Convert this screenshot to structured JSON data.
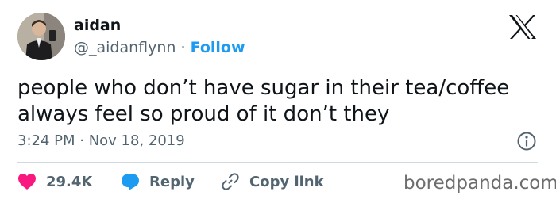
{
  "author": {
    "name": "aidan",
    "handle": "@_aidanflynn",
    "separator": "·",
    "follow_label": "Follow"
  },
  "tweet": {
    "text": "people who don’t have sugar in their tea/coffee always feel so proud of it don’t they",
    "timestamp": "3:24 PM · Nov 18, 2019"
  },
  "actions": {
    "likes": "29.4K",
    "reply_label": "Reply",
    "copy_link_label": "Copy link"
  },
  "watermark": "boredpanda.com",
  "colors": {
    "accent": "#1d9bf0",
    "like": "#f91880",
    "text": "#0f1419",
    "secondary": "#536471"
  },
  "icons": [
    "avatar",
    "x-logo-icon",
    "info-icon",
    "heart-icon",
    "reply-bubble-icon",
    "link-icon"
  ]
}
